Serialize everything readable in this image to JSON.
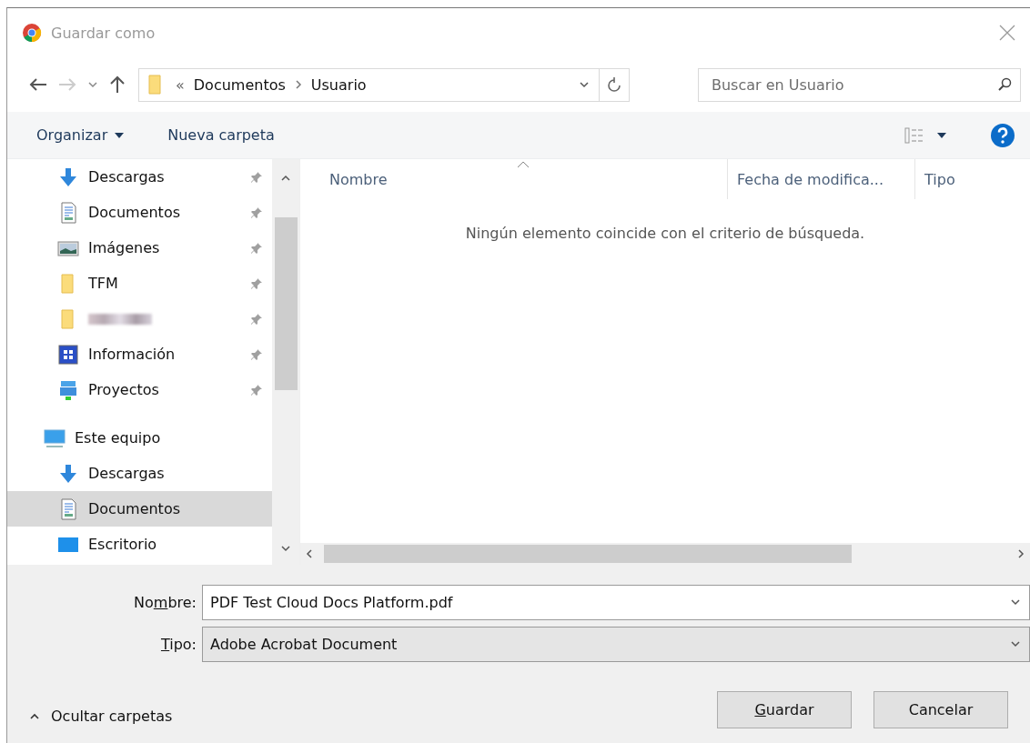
{
  "window": {
    "title": "Guardar como"
  },
  "address": {
    "overflow": "«",
    "crumbs": [
      "Documentos",
      "Usuario"
    ]
  },
  "search": {
    "placeholder": "Buscar en Usuario"
  },
  "toolbar": {
    "organize": "Organizar",
    "new_folder": "Nueva carpeta"
  },
  "sidebar": {
    "items": [
      {
        "kind": "download",
        "label": "Descargas",
        "pinned": true,
        "selected": false
      },
      {
        "kind": "document",
        "label": "Documentos",
        "pinned": true,
        "selected": false
      },
      {
        "kind": "image",
        "label": "Imágenes",
        "pinned": true,
        "selected": false
      },
      {
        "kind": "folder",
        "label": "TFM",
        "pinned": true,
        "selected": false
      },
      {
        "kind": "folder",
        "redacted": true,
        "pinned": true,
        "selected": false
      },
      {
        "kind": "info",
        "label": "Información",
        "pinned": true,
        "selected": false
      },
      {
        "kind": "network",
        "label": "Proyectos",
        "pinned": true,
        "selected": false
      },
      {
        "kind": "computer",
        "label": "Este equipo",
        "pinned": false,
        "selected": false,
        "top": true
      },
      {
        "kind": "download",
        "label": "Descargas",
        "pinned": false,
        "selected": false
      },
      {
        "kind": "document",
        "label": "Documentos",
        "pinned": false,
        "selected": true
      },
      {
        "kind": "desktop",
        "label": "Escritorio",
        "pinned": false,
        "selected": false
      }
    ]
  },
  "table": {
    "columns": [
      "Nombre",
      "Fecha de modifica...",
      "Tipo"
    ],
    "empty_message": "Ningún elemento coincide con el criterio de búsqueda."
  },
  "fields": [
    {
      "label": {
        "pre": "No",
        "key": "m",
        "post": "bre:"
      },
      "value": "PDF Test Cloud Docs Platform.pdf",
      "editable": true
    },
    {
      "label": {
        "key": "T",
        "post": "ipo:"
      },
      "value": "Adobe Acrobat Document",
      "editable": false
    }
  ],
  "hide_folders": "Ocultar carpetas",
  "buttons": [
    {
      "label": {
        "key": "G",
        "post": "uardar"
      }
    },
    {
      "label": {
        "pre": "Cancelar"
      }
    }
  ]
}
